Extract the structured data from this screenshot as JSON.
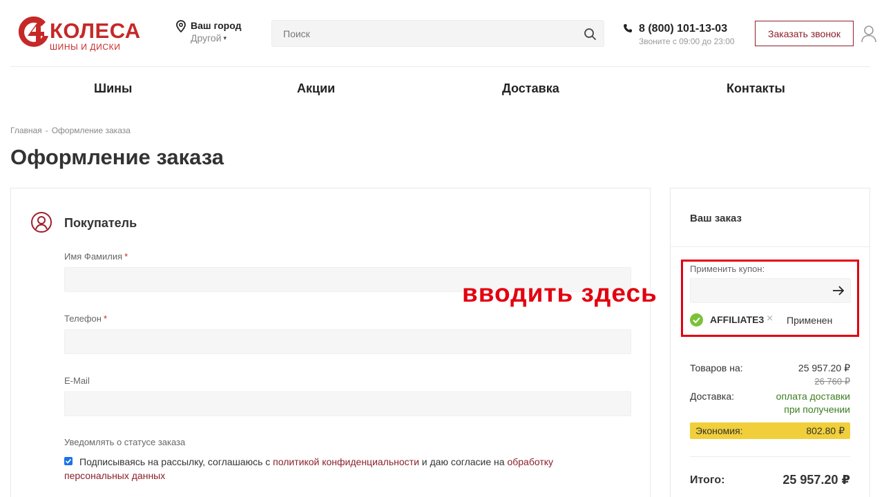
{
  "header": {
    "logo": {
      "title": "КОЛЕСА",
      "subtitle": "шины и диски",
      "mark_text": "4",
      "brand_color": "#c62828"
    },
    "city": {
      "label": "Ваш город",
      "value": "Другой",
      "caret": "▾",
      "icon": "map-pin-icon"
    },
    "search": {
      "placeholder": "Поиск",
      "value": "",
      "icon": "search-icon"
    },
    "phone": {
      "number": "8 (800) 101-13-03",
      "hours": "Звоните с 09:00 до 23:00",
      "icon": "phone-icon"
    },
    "callback_label": "Заказать звонок",
    "accent_color": "#8b1f2a",
    "user_icon": "user-icon"
  },
  "nav": {
    "items": [
      {
        "label": "Шины"
      },
      {
        "label": "Акции"
      },
      {
        "label": "Доставка"
      },
      {
        "label": "Контакты"
      }
    ]
  },
  "breadcrumb": {
    "items": [
      "Главная",
      "Оформление заказа"
    ],
    "separator": "-"
  },
  "page_title": "Оформление заказа",
  "buyer": {
    "title": "Покупатель",
    "icon": "user-circle-icon",
    "fields": [
      {
        "label": "Имя Фамилия",
        "required": "*",
        "value": ""
      },
      {
        "label": "Телефон",
        "required": "*",
        "value": ""
      },
      {
        "label": "E-Mail",
        "required": "",
        "value": ""
      }
    ],
    "notify_label": "Уведомлять о статусе заказа",
    "consent": {
      "checked": true,
      "text_before": "Подписываясь на рассылку, соглашаюсь с ",
      "link1": "политикой конфиденциальности",
      "text_middle": " и даю согласие на ",
      "link2": "обработку персональных данных"
    }
  },
  "annotation": {
    "text": "вводить здесь",
    "color": "#e3000f"
  },
  "order": {
    "title": "Ваш заказ",
    "coupon": {
      "label": "Применить купон:",
      "placeholder": "",
      "value": "",
      "apply_icon": "arrow-right-icon",
      "applied_code": "AFFILIATE3",
      "remove_symbol": "×",
      "status": "Применен",
      "status_icon": "check-circle-icon",
      "status_color": "#7cc13a"
    },
    "summary": {
      "goods_label": "Товаров на:",
      "goods_value": "25 957.20 ₽",
      "goods_old_value": "26 760 ₽",
      "delivery_label": "Доставка:",
      "delivery_value_line1": "оплата доставки",
      "delivery_value_line2": "при получении",
      "economy_label": "Экономия:",
      "economy_value": "802.80 ₽",
      "economy_color": "#f1cf3a",
      "total_label": "Итого:",
      "total_value": "25 957.20 ₽"
    }
  }
}
